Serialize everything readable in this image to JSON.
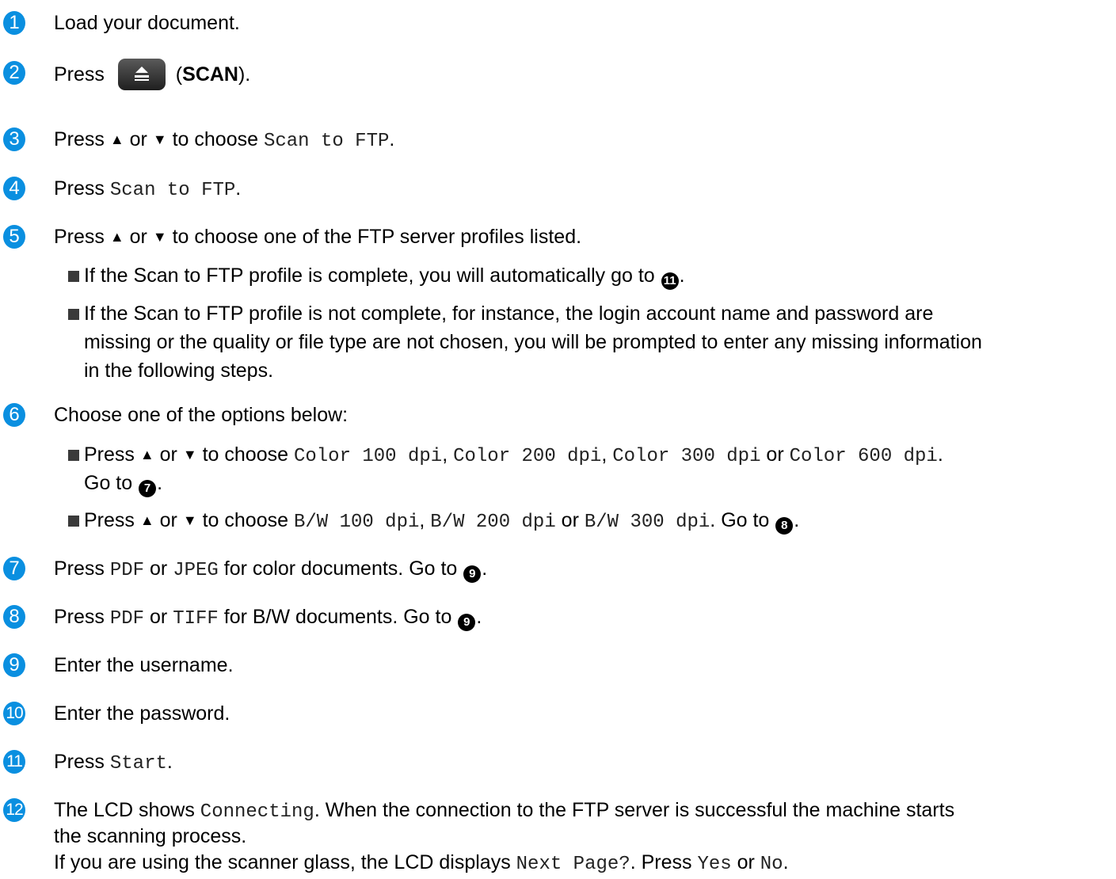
{
  "steps": {
    "s1": {
      "num": "1",
      "text": "Load your document."
    },
    "s2": {
      "num": "2",
      "pre": "Press ",
      "label": "SCAN",
      "open": " (",
      "close": ")."
    },
    "s3": {
      "num": "3",
      "a": "Press ",
      "up": "▲",
      "or": " or ",
      "down": "▼",
      "b": " to choose ",
      "code": "Scan to FTP",
      "end": "."
    },
    "s4": {
      "num": "4",
      "a": "Press ",
      "code": "Scan to FTP",
      "end": "."
    },
    "s5": {
      "num": "5",
      "a": "Press ",
      "up": "▲",
      "or": " or ",
      "down": "▼",
      "b": " to choose one of the FTP server profiles listed.",
      "bullet1_a": "If the Scan to FTP profile is complete, you will automatically go to ",
      "bullet1_ref": "11",
      "bullet1_end": ".",
      "bullet2_l1": "If the Scan to FTP profile is not complete, for instance, the login account name and password are",
      "bullet2_l2": "missing or the quality or file type are not chosen, you will be prompted to enter any missing information",
      "bullet2_l3": "in the following steps."
    },
    "s6": {
      "num": "6",
      "text": "Choose one of the options below:",
      "b1_a": "Press ",
      "up": "▲",
      "or": " or ",
      "down": "▼",
      "b1_b": " to choose ",
      "c1": "Color 100 dpi",
      "c2": "Color 200 dpi",
      "c3": "Color 300 dpi",
      "c4": "Color 600 dpi",
      "comma": ", ",
      "or2": " or ",
      "dot": ".",
      "b1_goto": "Go to ",
      "b1_ref": "7",
      "b1_end": ".",
      "b2_a": "Press ",
      "b2_b": " to choose ",
      "d1": "B/W 100 dpi",
      "d2": "B/W 200 dpi",
      "d3": "B/W 300 dpi",
      "b2_goto": ". Go to ",
      "b2_ref": "8",
      "b2_end": "."
    },
    "s7": {
      "num": "7",
      "a": "Press ",
      "c1": "PDF",
      "or": " or ",
      "c2": "JPEG",
      "b": " for color documents. Go to ",
      "ref": "9",
      "end": "."
    },
    "s8": {
      "num": "8",
      "a": "Press ",
      "c1": "PDF",
      "or": " or ",
      "c2": "TIFF",
      "b": " for B/W documents. Go to ",
      "ref": "9",
      "end": "."
    },
    "s9": {
      "num": "9",
      "text": "Enter the username."
    },
    "s10": {
      "num": "10",
      "text": "Enter the password."
    },
    "s11": {
      "num": "11",
      "a": "Press ",
      "code": "Start",
      "end": "."
    },
    "s12": {
      "num": "12",
      "a": "The LCD shows ",
      "code": "Connecting",
      "b": ". When the connection to the FTP server is successful the machine starts",
      "l2": "the scanning process.",
      "l3a": "If you are using the scanner glass, the LCD displays ",
      "code2": "Next Page?",
      "l3b": ". Press ",
      "yes": "Yes",
      "or": " or ",
      "no": "No",
      "end": "."
    }
  },
  "colors": {
    "badge": "#0a8fe0",
    "scan_button": "#2b2b2b"
  },
  "icons": {
    "scan_button": "scan-icon"
  }
}
